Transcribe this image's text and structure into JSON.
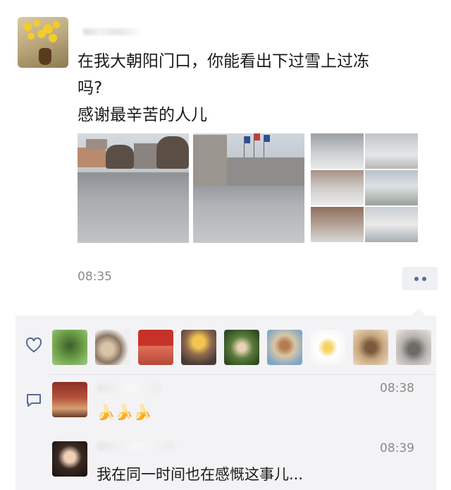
{
  "post": {
    "author_avatar": "poster-avatar-flowers",
    "text_lines": [
      "在我大朝阳门口，你能看出下过雪上过冻",
      "吗?",
      "感谢最辛苦的人儿"
    ],
    "time": "08:35",
    "more_icon": "more-dots-icon"
  },
  "likes": {
    "icon": "heart-icon",
    "avatars": [
      "like-avatar-1",
      "like-avatar-2",
      "like-avatar-3",
      "like-avatar-4",
      "like-avatar-5",
      "like-avatar-6",
      "like-avatar-7",
      "like-avatar-8",
      "like-avatar-9"
    ]
  },
  "comments": {
    "icon": "comment-icon",
    "items": [
      {
        "time": "08:38",
        "text": "🍌🍌🍌"
      },
      {
        "time": "08:39",
        "text": "我在同一时间也在感慨这事儿..."
      }
    ]
  },
  "colors": {
    "link_blue": "#576b95",
    "panel_bg": "#f3f3f5",
    "timestamp_gray": "#8a8a8a"
  }
}
